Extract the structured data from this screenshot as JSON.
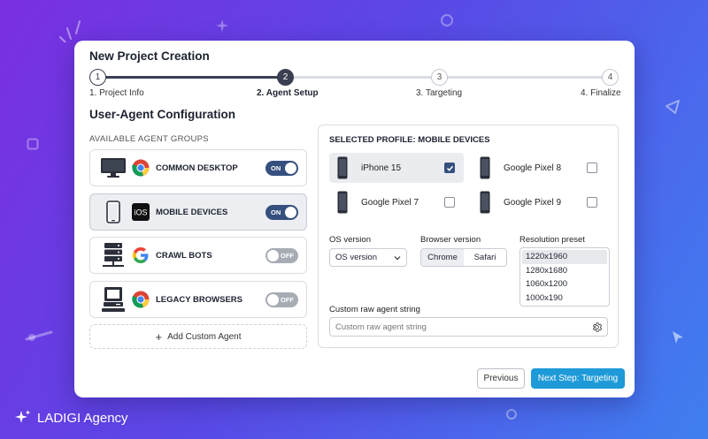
{
  "card": {
    "title": "New Project Creation"
  },
  "stepper": {
    "steps": [
      {
        "number": "1",
        "label": "1. Project Info"
      },
      {
        "number": "2",
        "label": "2. Agent Setup"
      },
      {
        "number": "3",
        "label": "3. Targeting"
      },
      {
        "number": "4",
        "label": "4. Finalize"
      }
    ],
    "active_step": 2
  },
  "section_title": "User-Agent Configuration",
  "groups": {
    "title": "AVAILABLE AGENT GROUPS",
    "items": [
      {
        "name": "COMMON DESKTOP",
        "toggle": "ON",
        "device_icon": "desktop-monitor-icon",
        "brand_icon": "chrome-icon"
      },
      {
        "name": "MOBILE DEVICES",
        "toggle": "ON",
        "device_icon": "smartphone-icon",
        "brand_icon": "ios-icon",
        "brand_text": "iOS"
      },
      {
        "name": "CRAWL BOTS",
        "toggle": "OFF",
        "device_icon": "server-network-icon",
        "brand_icon": "google-icon"
      },
      {
        "name": "LEGACY BROWSERS",
        "toggle": "OFF",
        "device_icon": "retro-computer-icon",
        "brand_icon": "chrome-icon"
      }
    ],
    "add_button": "Add Custom Agent"
  },
  "profile": {
    "title": "SELECTED PROFILE: MOBILE DEVICES",
    "devices": [
      {
        "name": "iPhone 15",
        "checked": true
      },
      {
        "name": "Google Pixel 8",
        "checked": false
      },
      {
        "name": "Google Pixel 7",
        "checked": false
      },
      {
        "name": "Google Pixel 9",
        "checked": false
      }
    ],
    "os_version": {
      "label": "OS version",
      "value": "OS version"
    },
    "browser_version": {
      "label": "Browser version",
      "options": [
        "Chrome",
        "Safari"
      ],
      "selected": "Chrome"
    },
    "resolution": {
      "label": "Resolution preset",
      "options": [
        "1220x1960",
        "1280x1680",
        "1060x1200",
        "1000x190"
      ],
      "selected": "1220x1960"
    },
    "raw_string": {
      "label": "Custom raw agent string",
      "placeholder": "Custom raw agent string"
    }
  },
  "buttons": {
    "previous": "Previous",
    "next": "Next Step: Targeting"
  },
  "brand": {
    "name": "LADIGI Agency"
  },
  "colors": {
    "accent": "#1e9ad8",
    "toggle_on": "#35507e",
    "step_active": "#3a3f52"
  }
}
